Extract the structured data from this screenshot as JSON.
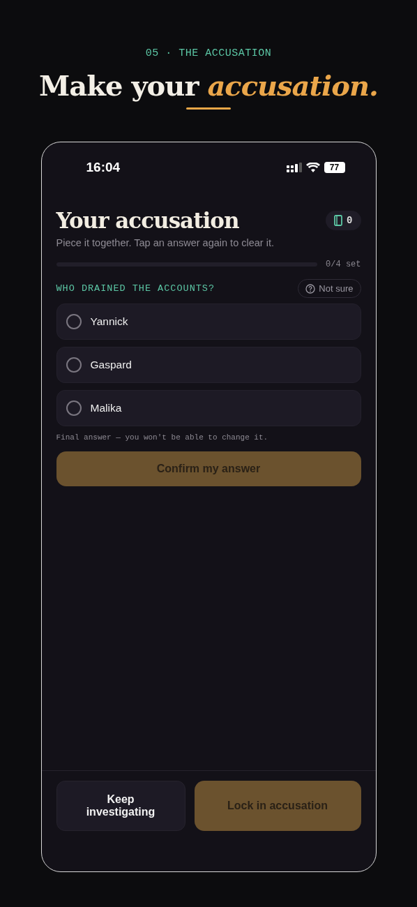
{
  "eyebrow": "05 · THE ACCUSATION",
  "headline": "Make your *accusation.*",
  "phone": {
    "status_bar": {
      "time": "16:04",
      "battery": "77"
    },
    "title": "Your accusation",
    "notes_badge": {
      "count": "0"
    },
    "subtitle": "Piece it together. Tap an answer again to clear it.",
    "progress": {
      "level": 0,
      "reading": "0/4 set"
    },
    "question": {
      "label": "WHO DRAINED THE ACCOUNTS?",
      "not_sure": "Not sure",
      "options": [
        {
          "label": "Yannick",
          "selected": false
        },
        {
          "label": "Gaspard",
          "selected": false
        },
        {
          "label": "Malika",
          "selected": false
        }
      ],
      "note": "Final answer — you won't be able to change it.",
      "confirm": {
        "label": "Confirm my answer",
        "disabled": true
      }
    },
    "footer": {
      "secondary": {
        "label": "Keep investigating"
      },
      "primary": {
        "label": "Lock in accusation",
        "disabled": true
      }
    }
  }
}
